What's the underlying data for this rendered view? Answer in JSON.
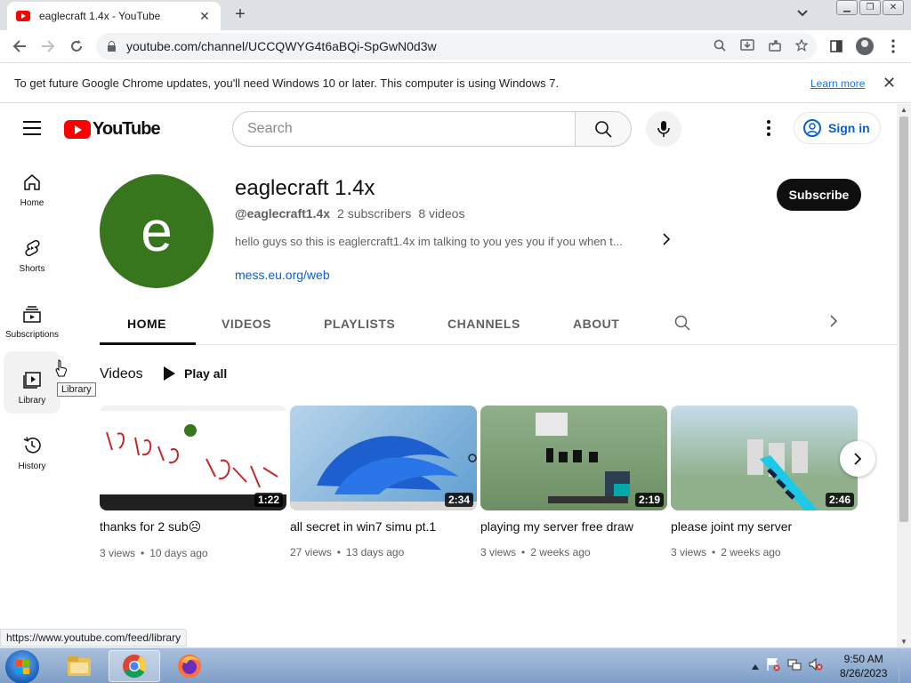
{
  "browser": {
    "tab_title": "eaglecraft 1.4x - YouTube",
    "tab_close": "✕",
    "new_tab": "+",
    "tab_search": "⌄",
    "url": "youtube.com/channel/UCCQWYG4t6aBQi-SpGwN0d3w",
    "window_buttons": [
      "▁",
      "❐",
      "✕"
    ]
  },
  "infobar": {
    "message": "To get future Google Chrome updates, you'll need Windows 10 or later. This computer is using Windows 7.",
    "learn_more": "Learn more",
    "close": "✕"
  },
  "masthead": {
    "logo_text": "YouTube",
    "search_placeholder": "Search",
    "sign_in": "Sign in"
  },
  "guide": {
    "items": [
      {
        "label": "Home",
        "icon": "home-icon"
      },
      {
        "label": "Shorts",
        "icon": "shorts-icon"
      },
      {
        "label": "Subscriptions",
        "icon": "subscriptions-icon"
      },
      {
        "label": "Library",
        "icon": "library-icon"
      },
      {
        "label": "History",
        "icon": "history-icon"
      }
    ],
    "tooltip": "Library"
  },
  "channel": {
    "avatar_letter": "e",
    "avatar_color": "#38761d",
    "name": "eaglecraft 1.4x",
    "handle": "@eaglecraft1.4x",
    "subscribers": "2 subscribers",
    "videos_count": "8 videos",
    "description": "hello guys so this is eaglercraft1.4x im talking to you yes you if you when t...",
    "link": "mess.eu.org/web",
    "subscribe_label": "Subscribe"
  },
  "tabs": [
    "HOME",
    "VIDEOS",
    "PLAYLISTS",
    "CHANNELS",
    "ABOUT"
  ],
  "shelf": {
    "title": "Videos",
    "play_all": "Play all",
    "videos": [
      {
        "title": "thanks for 2 sub☹",
        "views": "3 views",
        "age": "10 days ago",
        "duration": "1:22"
      },
      {
        "title": "all secret in win7 simu pt.1",
        "views": "27 views",
        "age": "13 days ago",
        "duration": "2:34"
      },
      {
        "title": "playing my server free draw",
        "views": "3 views",
        "age": "2 weeks ago",
        "duration": "2:19"
      },
      {
        "title": "please joint my server",
        "views": "3 views",
        "age": "2 weeks ago",
        "duration": "2:46"
      }
    ]
  },
  "status_url": "https://www.youtube.com/feed/library",
  "taskbar": {
    "time": "9:50 AM",
    "date": "8/26/2023"
  }
}
